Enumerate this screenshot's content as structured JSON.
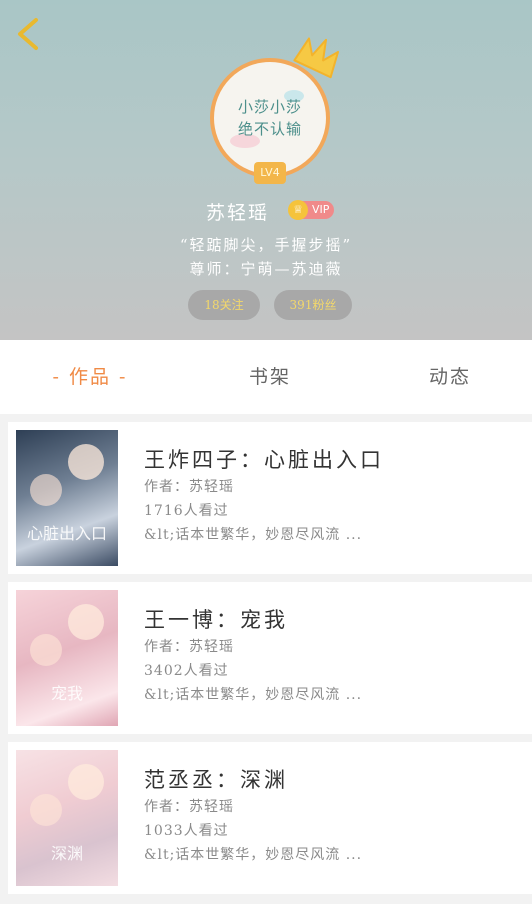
{
  "profile": {
    "avatar_text_line1": "小莎小莎",
    "avatar_text_line2": "绝不认输",
    "level": "LV4",
    "username": "苏轻瑶",
    "vip_label": "VIP",
    "motto": "“轻踮脚尖，手握步摇”",
    "teacher": "尊师：宁萌—苏迪薇",
    "following": "18关注",
    "fans": "391粉丝"
  },
  "tabs": [
    {
      "label": "- 作品 -",
      "active": true
    },
    {
      "label": "书架",
      "active": false
    },
    {
      "label": "动态",
      "active": false
    }
  ],
  "books": [
    {
      "title": "王炸四子：心脏出入口",
      "author": "作者：苏轻瑶",
      "views": "1716人看过",
      "description": "&lt;话本世繁华，妙恩尽风流 ...",
      "cover_text": "心脏出入口"
    },
    {
      "title": "王一博：宠我",
      "author": "作者：苏轻瑶",
      "views": "3402人看过",
      "description": "&lt;话本世繁华，妙恩尽风流 ...",
      "cover_text": "宠我"
    },
    {
      "title": "范丞丞：深渊",
      "author": "作者：苏轻瑶",
      "views": "1033人看过",
      "description": "&lt;话本世繁华，妙恩尽风流 ...",
      "cover_text": "深渊"
    }
  ],
  "colors": {
    "accent": "#f08a45",
    "pill_text": "#f3d86b",
    "avatar_ring": "#f2a85a",
    "vip_badge": "#f08a8a",
    "level_badge": "#f3b64a"
  },
  "icons": {
    "back": "chevron-left-icon",
    "crown": "crown-icon",
    "vip": "vip-crown-icon"
  }
}
